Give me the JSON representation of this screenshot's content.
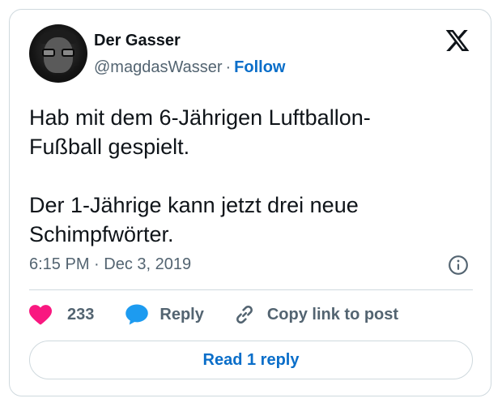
{
  "author": {
    "name": "Der Gasser",
    "handle": "@magdasWasser",
    "separator": "·",
    "follow_label": "Follow"
  },
  "tweet": {
    "text": "Hab mit dem 6-Jährigen Luftballon-\nFußball gespielt.\n\nDer 1-Jährige kann jetzt drei neue\nSchimpfwörter.",
    "timestamp": "6:15 PM · Dec 3, 2019"
  },
  "actions": {
    "like_count": "233",
    "reply_label": "Reply",
    "copy_label": "Copy link to post"
  },
  "footer": {
    "read_replies_label": "Read 1 reply"
  },
  "icons": {
    "logo": "x-logo-icon",
    "info": "info-icon",
    "like": "heart-icon",
    "reply": "speech-bubble-icon",
    "copy": "link-icon"
  },
  "colors": {
    "like": "#f91880",
    "reply": "#1d9bf0",
    "link_blue": "#0a6ec9",
    "secondary_text": "#536471",
    "border": "#cfd9de"
  }
}
